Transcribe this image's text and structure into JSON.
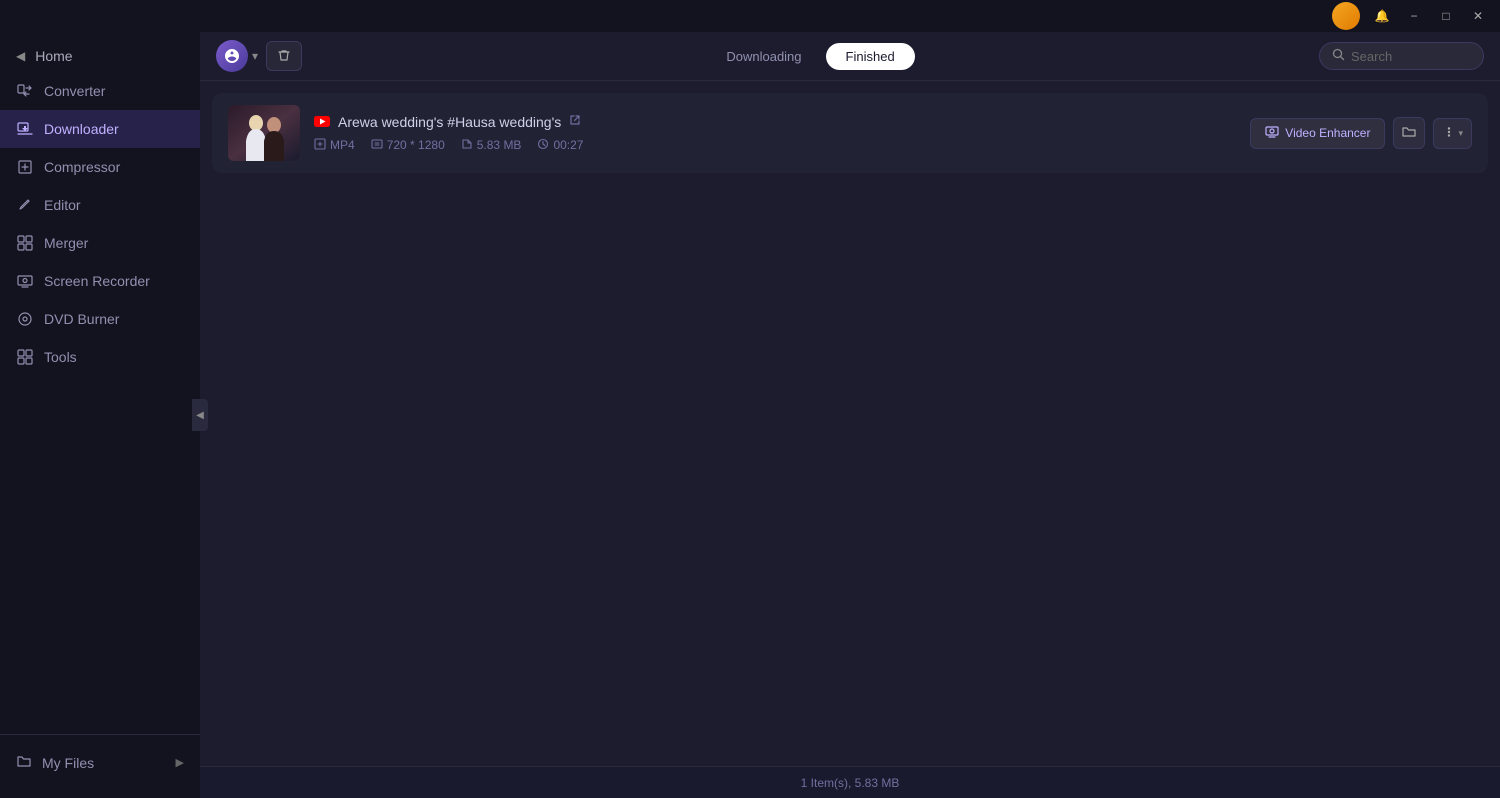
{
  "titlebar": {
    "minimize_label": "−",
    "maximize_label": "□",
    "close_label": "✕",
    "notification_icon": "🔔"
  },
  "sidebar": {
    "home_label": "Home",
    "items": [
      {
        "id": "converter",
        "label": "Converter",
        "icon": "⬡"
      },
      {
        "id": "downloader",
        "label": "Downloader",
        "icon": "⬇"
      },
      {
        "id": "compressor",
        "label": "Compressor",
        "icon": "⬛"
      },
      {
        "id": "editor",
        "label": "Editor",
        "icon": "✏"
      },
      {
        "id": "merger",
        "label": "Merger",
        "icon": "⊞"
      },
      {
        "id": "screen-recorder",
        "label": "Screen Recorder",
        "icon": "⬚"
      },
      {
        "id": "dvd-burner",
        "label": "DVD Burner",
        "icon": "◎"
      },
      {
        "id": "tools",
        "label": "Tools",
        "icon": "⊞"
      }
    ],
    "my_files_label": "My Files"
  },
  "toolbar": {
    "downloading_tab": "Downloading",
    "finished_tab": "Finished",
    "search_placeholder": "Search"
  },
  "download_item": {
    "title": "Arewa wedding's #Hausa wedding's",
    "format": "MP4",
    "resolution": "720 * 1280",
    "size": "5.83 MB",
    "duration": "00:27",
    "video_enhancer_label": "Video Enhancer"
  },
  "statusbar": {
    "text": "1 Item(s), 5.83 MB"
  },
  "colors": {
    "active_tab_bg": "#ffffff",
    "active_tab_text": "#1a1a2e",
    "active_sidebar_bg": "rgba(100,80,200,0.25)",
    "accent": "#7b5ccc"
  }
}
